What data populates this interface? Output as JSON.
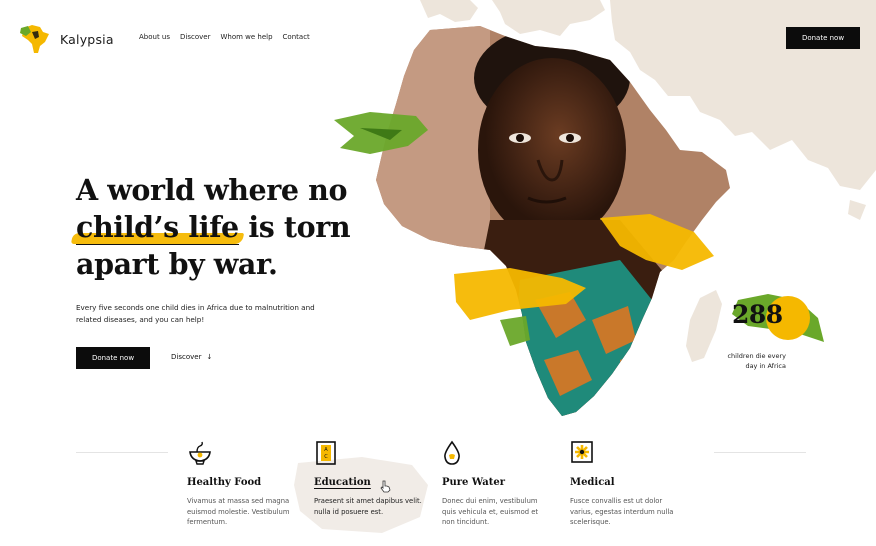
{
  "brand": {
    "name": "Kalypsia",
    "logo_icon": "africa-logo-icon"
  },
  "nav": {
    "items": [
      "About us",
      "Discover",
      "Whom we help",
      "Contact"
    ]
  },
  "header": {
    "donate_label": "Donate now"
  },
  "hero": {
    "title_line1": "A world where no",
    "title_highlight": "child’s life",
    "title_line2_rest": " is torn",
    "title_line3": "apart by war.",
    "description": "Every five seconds one child dies in Africa due to malnutrition and related diseases, and you can help!",
    "donate_label": "Donate now",
    "discover_label": "Discover",
    "discover_icon": "arrow-down-icon"
  },
  "stat": {
    "number": "288",
    "label": "children die every day in Africa"
  },
  "features": [
    {
      "icon": "food-bowl-icon",
      "title": "Healthy Food",
      "description": "Vivamus at massa sed magna euismod molestie. Vestibulum fermentum."
    },
    {
      "icon": "book-icon",
      "title": "Education",
      "description": "Praesent sit amet dapibus velit. nulla id posuere est."
    },
    {
      "icon": "water-drop-icon",
      "title": "Pure Water",
      "description": "Donec dui enim, vestibulum quis vehicula et, euismod et non tincidunt."
    },
    {
      "icon": "medical-cross-icon",
      "title": "Medical",
      "description": "Fusce convallis est ut dolor varius, egestas interdum nulla scelerisque."
    }
  ],
  "colors": {
    "accent_yellow": "#f5b800",
    "accent_green": "#6aa82a",
    "map_beige": "#ece4da",
    "button_black": "#0c0c0c"
  }
}
